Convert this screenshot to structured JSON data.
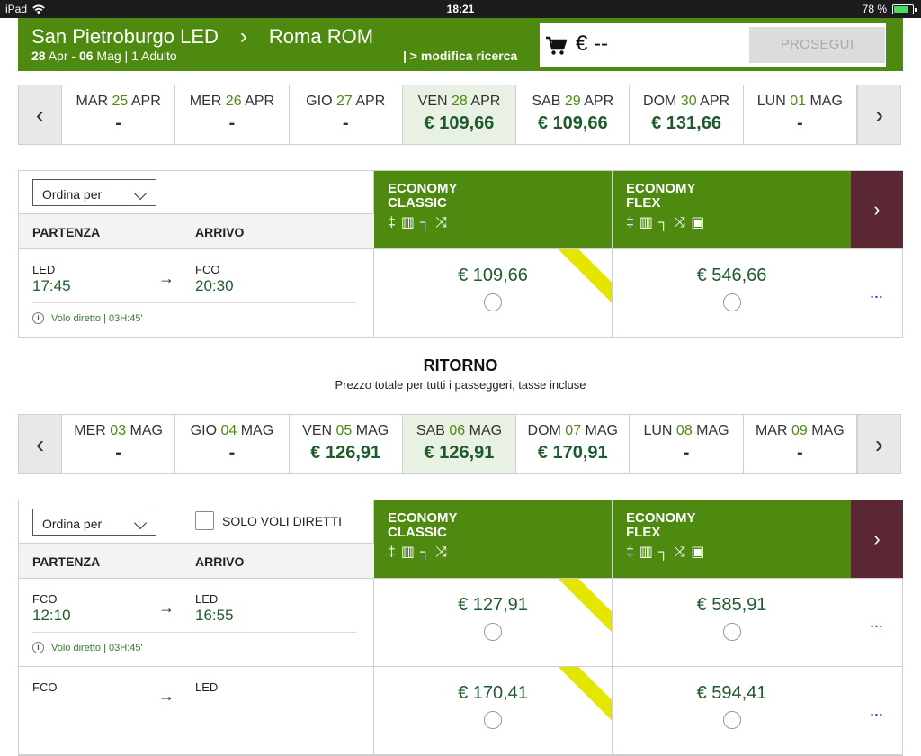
{
  "status": {
    "device": "iPad",
    "time": "18:21",
    "battery": "78 %",
    "battery_level": 0.78
  },
  "header": {
    "origin": "San Pietroburgo LED",
    "destination": "Roma ROM",
    "date_from": "28",
    "month_from": "Apr",
    "date_to": "06",
    "month_to": "Mag",
    "passengers": "| 1 Adulto",
    "modify": "| > modifica ricerca",
    "cart_total": "€ --",
    "proceed": "PROSEGUI"
  },
  "outbound_dates": [
    {
      "dow": "MAR",
      "day": "25",
      "month": "APR",
      "price": "-"
    },
    {
      "dow": "MER",
      "day": "26",
      "month": "APR",
      "price": "-"
    },
    {
      "dow": "GIO",
      "day": "27",
      "month": "APR",
      "price": "-"
    },
    {
      "dow": "VEN",
      "day": "28",
      "month": "APR",
      "price": "€ 109,66",
      "selected": true
    },
    {
      "dow": "SAB",
      "day": "29",
      "month": "APR",
      "price": "€ 109,66"
    },
    {
      "dow": "DOM",
      "day": "30",
      "month": "APR",
      "price": "€ 131,66"
    },
    {
      "dow": "LUN",
      "day": "01",
      "month": "MAG",
      "price": "-"
    }
  ],
  "table_labels": {
    "sort": "Ordina per",
    "departure": "PARTENZA",
    "arrival": "ARRIVO",
    "direct_only": "SOLO VOLI DIRETTI",
    "fare1_line1": "ECONOMY",
    "fare1_line2": "CLASSIC",
    "fare2_line1": "ECONOMY",
    "fare2_line2": "FLEX",
    "more": "..."
  },
  "outbound_flights": [
    {
      "from": "LED",
      "dep": "17:45",
      "to": "FCO",
      "arr": "20:30",
      "info": "Volo diretto | 03H:45'",
      "classic": "€ 109,66",
      "flex": "€ 546,66"
    }
  ],
  "return": {
    "title": "RITORNO",
    "subtitle": "Prezzo totale per tutti i passeggeri, tasse incluse"
  },
  "return_dates": [
    {
      "dow": "MER",
      "day": "03",
      "month": "MAG",
      "price": "-"
    },
    {
      "dow": "GIO",
      "day": "04",
      "month": "MAG",
      "price": "-"
    },
    {
      "dow": "VEN",
      "day": "05",
      "month": "MAG",
      "price": "€ 126,91"
    },
    {
      "dow": "SAB",
      "day": "06",
      "month": "MAG",
      "price": "€ 126,91",
      "selected": true
    },
    {
      "dow": "DOM",
      "day": "07",
      "month": "MAG",
      "price": "€ 170,91"
    },
    {
      "dow": "LUN",
      "day": "08",
      "month": "MAG",
      "price": "-"
    },
    {
      "dow": "MAR",
      "day": "09",
      "month": "MAG",
      "price": "-"
    }
  ],
  "return_flights": [
    {
      "from": "FCO",
      "dep": "12:10",
      "to": "LED",
      "arr": "16:55",
      "info": "Volo diretto | 03H:45'",
      "classic": "€ 127,91",
      "flex": "€ 585,91"
    },
    {
      "from": "FCO",
      "dep": "",
      "to": "LED",
      "arr": "",
      "info": "",
      "classic": "€ 170,41",
      "flex": "€ 594,41"
    }
  ],
  "icons": [
    "cart-icon",
    "hand-baggage-icon",
    "checked-baggage-icon",
    "seat-icon",
    "change-icon",
    "refund-icon"
  ],
  "colors": {
    "brand_green": "#4e8a0f",
    "dark_green": "#1f5a2c",
    "maroon": "#5b2732",
    "ribbon": "#e5e600"
  }
}
